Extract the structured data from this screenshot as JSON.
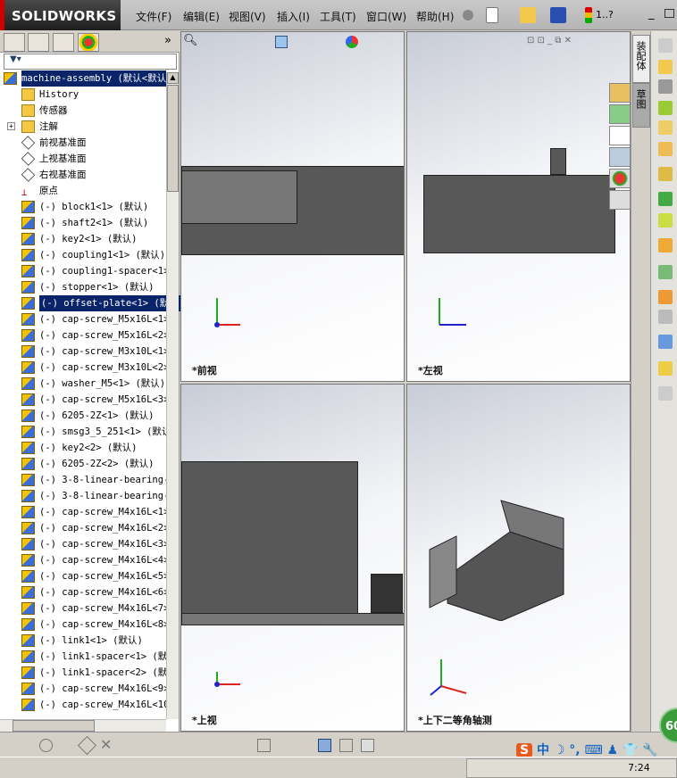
{
  "app": {
    "logo": "SOLIDWORKS",
    "menus": [
      "文件(F)",
      "编辑(E)",
      "视图(V)",
      "插入(I)",
      "工具(T)",
      "窗口(W)",
      "帮助(H)"
    ],
    "help_label": "1..?"
  },
  "tree": {
    "filter_icon": "filter-icon",
    "root": "machine-assembly  (默认<默认",
    "items": [
      {
        "label": "History",
        "icon": "history"
      },
      {
        "label": "传感器",
        "icon": "folder"
      },
      {
        "label": "注解",
        "icon": "folder",
        "expand": "+"
      },
      {
        "label": "前视基准面",
        "icon": "plane"
      },
      {
        "label": "上视基准面",
        "icon": "plane"
      },
      {
        "label": "右视基准面",
        "icon": "plane"
      },
      {
        "label": "原点",
        "icon": "origin"
      },
      {
        "label": "(-) block1<1> (默认)",
        "icon": "comp"
      },
      {
        "label": "(-) shaft2<1> (默认)",
        "icon": "comp"
      },
      {
        "label": "(-) key2<1> (默认)",
        "icon": "comp"
      },
      {
        "label": "(-) coupling1<1> (默认)",
        "icon": "comp"
      },
      {
        "label": "(-) coupling1-spacer<1>",
        "icon": "comp"
      },
      {
        "label": "(-) stopper<1> (默认)",
        "icon": "comp"
      },
      {
        "label": "(-) offset-plate<1> (默认",
        "icon": "comp",
        "selected": true
      },
      {
        "label": "(-) cap-screw_M5x16L<1>",
        "icon": "comp"
      },
      {
        "label": "(-) cap-screw_M5x16L<2>",
        "icon": "comp"
      },
      {
        "label": "(-) cap-screw_M3x10L<1>",
        "icon": "comp"
      },
      {
        "label": "(-) cap-screw_M3x10L<2>",
        "icon": "comp"
      },
      {
        "label": "(-) washer_M5<1> (默认)",
        "icon": "comp"
      },
      {
        "label": "(-) cap-screw_M5x16L<3>",
        "icon": "comp"
      },
      {
        "label": "(-) 6205-2Z<1> (默认)",
        "icon": "comp"
      },
      {
        "label": "(-) smsg3_5_251<1> (默认",
        "icon": "comp"
      },
      {
        "label": "(-) key2<2> (默认)",
        "icon": "comp"
      },
      {
        "label": "(-) 6205-2Z<2> (默认)",
        "icon": "comp"
      },
      {
        "label": "(-) 3-8-linear-bearing-b",
        "icon": "comp"
      },
      {
        "label": "(-) 3-8-linear-bearing-b",
        "icon": "comp"
      },
      {
        "label": "(-) cap-screw_M4x16L<1>",
        "icon": "comp"
      },
      {
        "label": "(-) cap-screw_M4x16L<2>",
        "icon": "comp"
      },
      {
        "label": "(-) cap-screw_M4x16L<3>",
        "icon": "comp"
      },
      {
        "label": "(-) cap-screw_M4x16L<4>",
        "icon": "comp"
      },
      {
        "label": "(-) cap-screw_M4x16L<5>",
        "icon": "comp"
      },
      {
        "label": "(-) cap-screw_M4x16L<6>",
        "icon": "comp"
      },
      {
        "label": "(-) cap-screw_M4x16L<7>",
        "icon": "comp"
      },
      {
        "label": "(-) cap-screw_M4x16L<8>",
        "icon": "comp"
      },
      {
        "label": "(-) link1<1> (默认)",
        "icon": "comp"
      },
      {
        "label": "(-) link1-spacer<1> (默i",
        "icon": "comp"
      },
      {
        "label": "(-) link1-spacer<2> (默i",
        "icon": "comp"
      },
      {
        "label": "(-) cap-screw_M4x16L<9>",
        "icon": "comp"
      },
      {
        "label": "(-) cap-screw_M4x16L<10>",
        "icon": "comp"
      }
    ]
  },
  "viewports": [
    {
      "label": "*前视"
    },
    {
      "label": "*左视"
    },
    {
      "label": "*上视"
    },
    {
      "label": "*上下二等角轴测"
    }
  ],
  "right_tabs": [
    "装配体",
    "草图"
  ],
  "status": {
    "badge": "60",
    "ime": "中",
    "clock": "7:24"
  },
  "colors": {
    "selection": "#0a246a",
    "title_accent": "#cc0000"
  }
}
